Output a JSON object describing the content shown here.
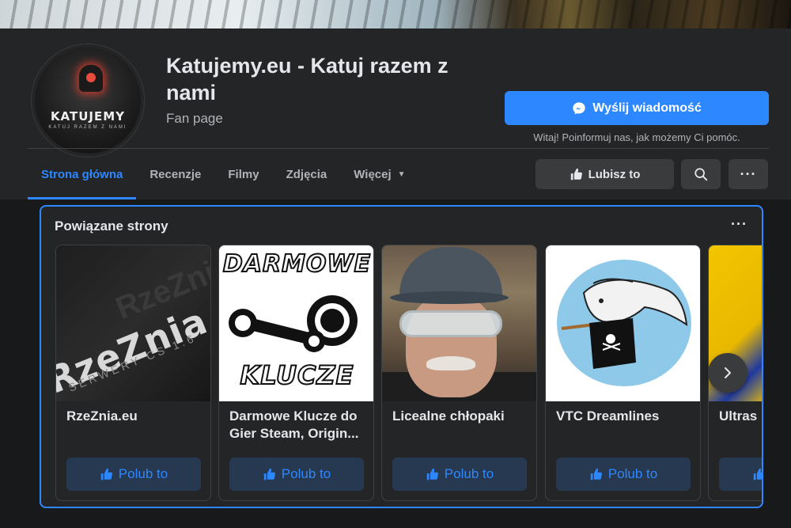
{
  "page": {
    "title": "Katujemy.eu - Katuj razem z nami",
    "category": "Fan page",
    "avatar_text": "KATUJEMY",
    "avatar_subtext": "KATUJ RAZEM Z NAMI"
  },
  "actions": {
    "message_label": "Wyślij wiadomość",
    "greeting": "Witaj! Poinformuj nas, jak możemy Ci pomóc.",
    "like_label": "Lubisz to"
  },
  "tabs": [
    {
      "label": "Strona główna",
      "active": true
    },
    {
      "label": "Recenzje",
      "active": false
    },
    {
      "label": "Filmy",
      "active": false
    },
    {
      "label": "Zdjęcia",
      "active": false
    },
    {
      "label": "Więcej",
      "active": false
    }
  ],
  "related": {
    "title": "Powiązane strony",
    "like_label": "Polub to",
    "items": [
      {
        "name": "RzeZnia.eu",
        "thumb_text": "RzeZnia.eu",
        "thumb_subtext": "SERWERY CS 1.6"
      },
      {
        "name": "Darmowe Klucze do Gier Steam, Origin...",
        "thumb_top": "DARMOWE",
        "thumb_bottom": "KLUCZE"
      },
      {
        "name": "Licealne chłopaki"
      },
      {
        "name": "VTC Dreamlines"
      },
      {
        "name": "Ultras"
      }
    ]
  },
  "colors": {
    "accent": "#2d88ff",
    "surface": "#242526",
    "background": "#18191a"
  },
  "icons": {
    "messenger": "messenger-icon",
    "thumb": "thumbs-up-icon",
    "search": "search-icon",
    "more": "more-horizontal-icon",
    "next": "chevron-right-icon",
    "caret": "caret-down-icon"
  }
}
